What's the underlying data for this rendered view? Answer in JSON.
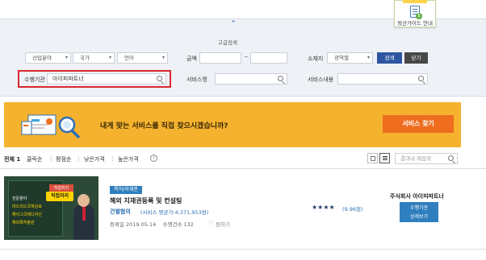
{
  "guide": {
    "label": "정산가이드 안내"
  },
  "search": {
    "collapse_icon": "chevron-up-icon",
    "advanced_title": "고급검색",
    "category_select": "산업분야",
    "country_select": "국가",
    "language_select": "언어",
    "price_label": "금액",
    "price_from": "",
    "price_to": "",
    "price_sep": "~",
    "region_label": "소재지",
    "region_select": "광역별",
    "agency_label": "수행기관",
    "agency_value": "아이피파트너",
    "service_name_label": "서비스명",
    "service_name_value": "",
    "service_content_label": "서비스내용",
    "service_content_value": "",
    "search_button": "검색",
    "close_button": "닫기"
  },
  "banner": {
    "text": "내게 맞는 서비스를 직접 찾으시겠습니까?",
    "button": "서비스 찾기",
    "bg_color": "#f5b22f",
    "button_color": "#ee6d1f"
  },
  "sortbar": {
    "total": "전체 1",
    "sorts": [
      "클릭순",
      "평점순",
      "낮은가격",
      "높은가격"
    ],
    "info_icon": "info-icon",
    "in_result_placeholder": "결과내 재검색"
  },
  "result": {
    "thumbnail": {
      "ribbon": "직접처리",
      "bubble": "직접처리",
      "lines": [
        "전문분야",
        "마드리드국제상표",
        "해이그국제디자인",
        "해외특허출원"
      ]
    },
    "tag": "특허/지재권",
    "title": "해외 지재권등록 및 컨설팅",
    "company": "건별협의",
    "avg_price": "(서비스 평균가:4,371,953원)",
    "reg_date": "등록일 2019.05.14",
    "count": "수행건수 132",
    "fav": "찜하기",
    "stars": "★★★★",
    "rating": "(9.96점)",
    "seller": "주식회사 아이피파트너",
    "detail_btn_line1": "수행기관",
    "detail_btn_line2": "상세보기",
    "accent_color": "#2f7fbf"
  }
}
